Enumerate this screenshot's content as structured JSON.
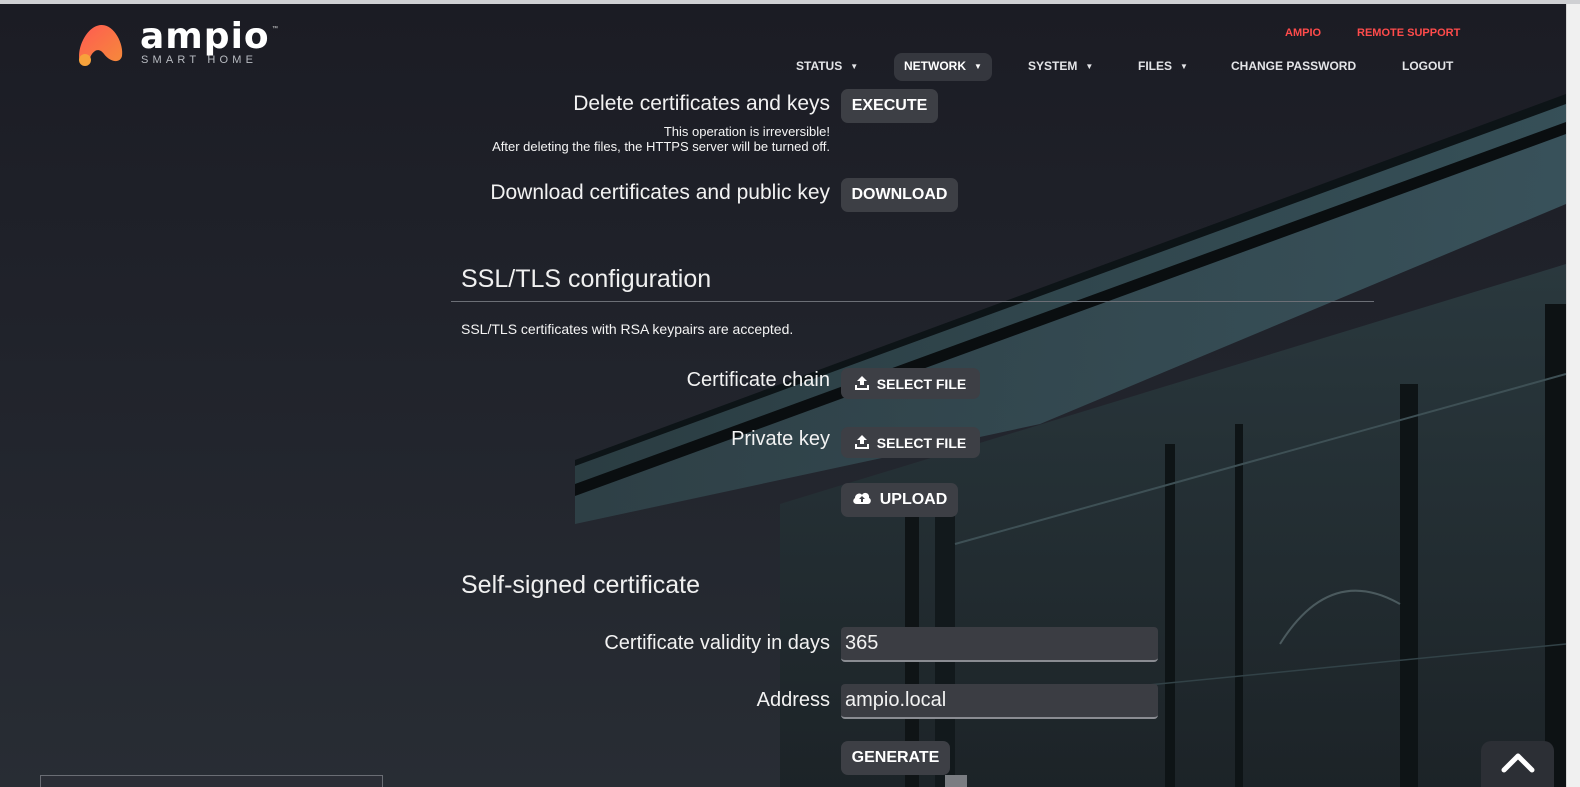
{
  "brand": {
    "name": "ampio",
    "tagline": "SMART HOME",
    "tm": "™",
    "accent": "#ff4b4b",
    "logo_gradient": [
      "#ff5a52",
      "#f58b3a"
    ]
  },
  "top_links": {
    "ampio": "AMPIO",
    "remote_support": "REMOTE SUPPORT"
  },
  "nav": {
    "status": "STATUS",
    "network": "NETWORK",
    "system": "SYSTEM",
    "files": "FILES",
    "change_password": "CHANGE PASSWORD",
    "logout": "LOGOUT",
    "caret": "▼",
    "active": "network"
  },
  "certs": {
    "delete_label": "Delete certificates and keys",
    "execute_button": "EXECUTE",
    "warning_line1": "This operation is irreversible!",
    "warning_line2": "After deleting the files, the HTTPS server will be turned off.",
    "download_label": "Download certificates and public key",
    "download_button": "DOWNLOAD"
  },
  "ssl": {
    "title": "SSL/TLS configuration",
    "description": "SSL/TLS certificates with RSA keypairs are accepted.",
    "chain_label": "Certificate chain",
    "chain_button": "SELECT FILE",
    "key_label": "Private key",
    "key_button": "SELECT FILE",
    "upload_button": "UPLOAD"
  },
  "selfsigned": {
    "title": "Self-signed certificate",
    "validity_label": "Certificate validity in days",
    "validity_value": "365",
    "address_label": "Address",
    "address_value": "ampio.local",
    "generate_button": "GENERATE"
  }
}
